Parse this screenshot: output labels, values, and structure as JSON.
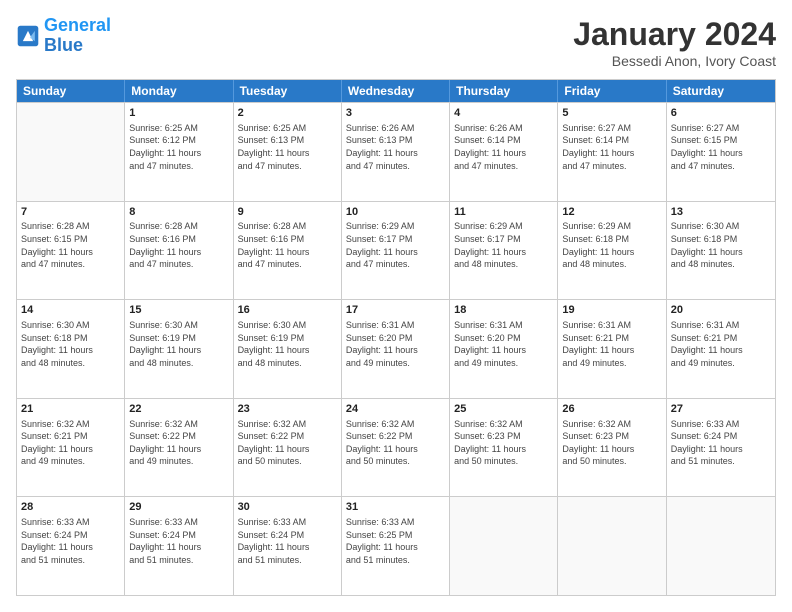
{
  "logo": {
    "line1": "General",
    "line2": "Blue"
  },
  "title": "January 2024",
  "subtitle": "Bessedi Anon, Ivory Coast",
  "days_header": [
    "Sunday",
    "Monday",
    "Tuesday",
    "Wednesday",
    "Thursday",
    "Friday",
    "Saturday"
  ],
  "weeks": [
    [
      {
        "day": "",
        "info": ""
      },
      {
        "day": "1",
        "info": "Sunrise: 6:25 AM\nSunset: 6:12 PM\nDaylight: 11 hours\nand 47 minutes."
      },
      {
        "day": "2",
        "info": "Sunrise: 6:25 AM\nSunset: 6:13 PM\nDaylight: 11 hours\nand 47 minutes."
      },
      {
        "day": "3",
        "info": "Sunrise: 6:26 AM\nSunset: 6:13 PM\nDaylight: 11 hours\nand 47 minutes."
      },
      {
        "day": "4",
        "info": "Sunrise: 6:26 AM\nSunset: 6:14 PM\nDaylight: 11 hours\nand 47 minutes."
      },
      {
        "day": "5",
        "info": "Sunrise: 6:27 AM\nSunset: 6:14 PM\nDaylight: 11 hours\nand 47 minutes."
      },
      {
        "day": "6",
        "info": "Sunrise: 6:27 AM\nSunset: 6:15 PM\nDaylight: 11 hours\nand 47 minutes."
      }
    ],
    [
      {
        "day": "7",
        "info": "Sunrise: 6:28 AM\nSunset: 6:15 PM\nDaylight: 11 hours\nand 47 minutes."
      },
      {
        "day": "8",
        "info": "Sunrise: 6:28 AM\nSunset: 6:16 PM\nDaylight: 11 hours\nand 47 minutes."
      },
      {
        "day": "9",
        "info": "Sunrise: 6:28 AM\nSunset: 6:16 PM\nDaylight: 11 hours\nand 47 minutes."
      },
      {
        "day": "10",
        "info": "Sunrise: 6:29 AM\nSunset: 6:17 PM\nDaylight: 11 hours\nand 47 minutes."
      },
      {
        "day": "11",
        "info": "Sunrise: 6:29 AM\nSunset: 6:17 PM\nDaylight: 11 hours\nand 48 minutes."
      },
      {
        "day": "12",
        "info": "Sunrise: 6:29 AM\nSunset: 6:18 PM\nDaylight: 11 hours\nand 48 minutes."
      },
      {
        "day": "13",
        "info": "Sunrise: 6:30 AM\nSunset: 6:18 PM\nDaylight: 11 hours\nand 48 minutes."
      }
    ],
    [
      {
        "day": "14",
        "info": "Sunrise: 6:30 AM\nSunset: 6:18 PM\nDaylight: 11 hours\nand 48 minutes."
      },
      {
        "day": "15",
        "info": "Sunrise: 6:30 AM\nSunset: 6:19 PM\nDaylight: 11 hours\nand 48 minutes."
      },
      {
        "day": "16",
        "info": "Sunrise: 6:30 AM\nSunset: 6:19 PM\nDaylight: 11 hours\nand 48 minutes."
      },
      {
        "day": "17",
        "info": "Sunrise: 6:31 AM\nSunset: 6:20 PM\nDaylight: 11 hours\nand 49 minutes."
      },
      {
        "day": "18",
        "info": "Sunrise: 6:31 AM\nSunset: 6:20 PM\nDaylight: 11 hours\nand 49 minutes."
      },
      {
        "day": "19",
        "info": "Sunrise: 6:31 AM\nSunset: 6:21 PM\nDaylight: 11 hours\nand 49 minutes."
      },
      {
        "day": "20",
        "info": "Sunrise: 6:31 AM\nSunset: 6:21 PM\nDaylight: 11 hours\nand 49 minutes."
      }
    ],
    [
      {
        "day": "21",
        "info": "Sunrise: 6:32 AM\nSunset: 6:21 PM\nDaylight: 11 hours\nand 49 minutes."
      },
      {
        "day": "22",
        "info": "Sunrise: 6:32 AM\nSunset: 6:22 PM\nDaylight: 11 hours\nand 49 minutes."
      },
      {
        "day": "23",
        "info": "Sunrise: 6:32 AM\nSunset: 6:22 PM\nDaylight: 11 hours\nand 50 minutes."
      },
      {
        "day": "24",
        "info": "Sunrise: 6:32 AM\nSunset: 6:22 PM\nDaylight: 11 hours\nand 50 minutes."
      },
      {
        "day": "25",
        "info": "Sunrise: 6:32 AM\nSunset: 6:23 PM\nDaylight: 11 hours\nand 50 minutes."
      },
      {
        "day": "26",
        "info": "Sunrise: 6:32 AM\nSunset: 6:23 PM\nDaylight: 11 hours\nand 50 minutes."
      },
      {
        "day": "27",
        "info": "Sunrise: 6:33 AM\nSunset: 6:24 PM\nDaylight: 11 hours\nand 51 minutes."
      }
    ],
    [
      {
        "day": "28",
        "info": "Sunrise: 6:33 AM\nSunset: 6:24 PM\nDaylight: 11 hours\nand 51 minutes."
      },
      {
        "day": "29",
        "info": "Sunrise: 6:33 AM\nSunset: 6:24 PM\nDaylight: 11 hours\nand 51 minutes."
      },
      {
        "day": "30",
        "info": "Sunrise: 6:33 AM\nSunset: 6:24 PM\nDaylight: 11 hours\nand 51 minutes."
      },
      {
        "day": "31",
        "info": "Sunrise: 6:33 AM\nSunset: 6:25 PM\nDaylight: 11 hours\nand 51 minutes."
      },
      {
        "day": "",
        "info": ""
      },
      {
        "day": "",
        "info": ""
      },
      {
        "day": "",
        "info": ""
      }
    ]
  ]
}
